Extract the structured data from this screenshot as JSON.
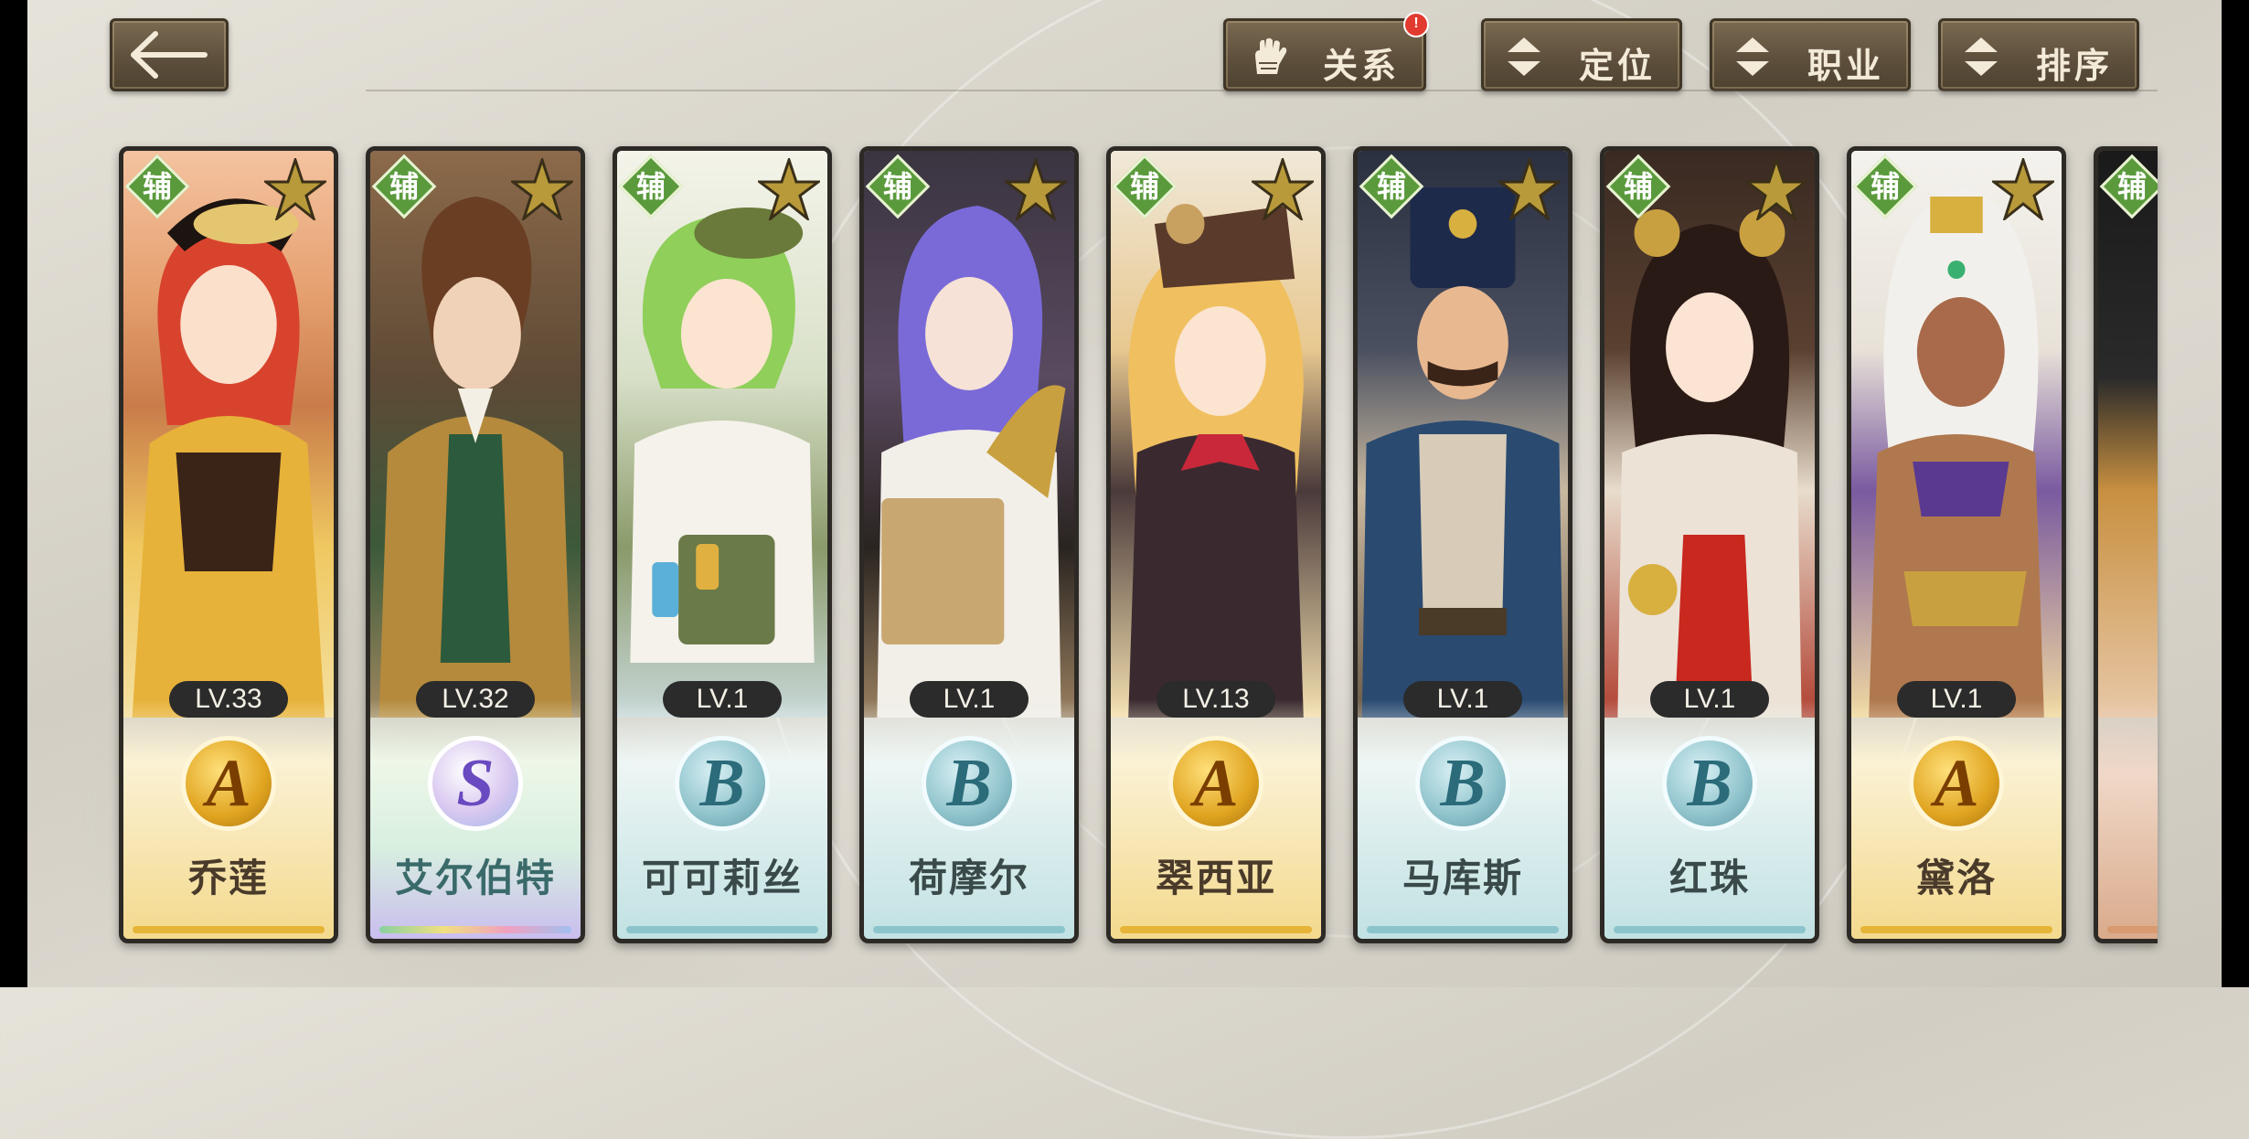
{
  "header": {
    "filters": [
      {
        "label": "关系",
        "icon": "glove-icon",
        "badge": "!"
      },
      {
        "label": "定位",
        "icon": "sort-arrows-icon"
      },
      {
        "label": "职业",
        "icon": "sort-arrows-icon"
      },
      {
        "label": "排序",
        "icon": "sort-arrows-icon"
      }
    ]
  },
  "cards": [
    {
      "name": "乔莲",
      "level": "LV.33",
      "grade": "A",
      "role": "辅",
      "tint": "gold"
    },
    {
      "name": "艾尔伯特",
      "level": "LV.32",
      "grade": "S",
      "role": "辅",
      "tint": "rainbow"
    },
    {
      "name": "可可莉丝",
      "level": "LV.1",
      "grade": "B",
      "role": "辅",
      "tint": "teal"
    },
    {
      "name": "荷摩尔",
      "level": "LV.1",
      "grade": "B",
      "role": "辅",
      "tint": "teal"
    },
    {
      "name": "翠西亚",
      "level": "LV.13",
      "grade": "A",
      "role": "辅",
      "tint": "gold"
    },
    {
      "name": "马库斯",
      "level": "LV.1",
      "grade": "B",
      "role": "辅",
      "tint": "teal"
    },
    {
      "name": "红珠",
      "level": "LV.1",
      "grade": "B",
      "role": "辅",
      "tint": "teal"
    },
    {
      "name": "黛洛",
      "level": "LV.1",
      "grade": "A",
      "role": "辅",
      "tint": "gold"
    },
    {
      "name": "",
      "level": "",
      "grade": "",
      "role": "辅",
      "tint": "copper"
    }
  ],
  "colors": {
    "gold_bottom": "#f3d88a",
    "teal_bottom": "#bfe0e2",
    "rainbow_bottom": "#d8efe0",
    "role_badge": "#5a9a3c",
    "level_pill": "#2b2b2b"
  }
}
